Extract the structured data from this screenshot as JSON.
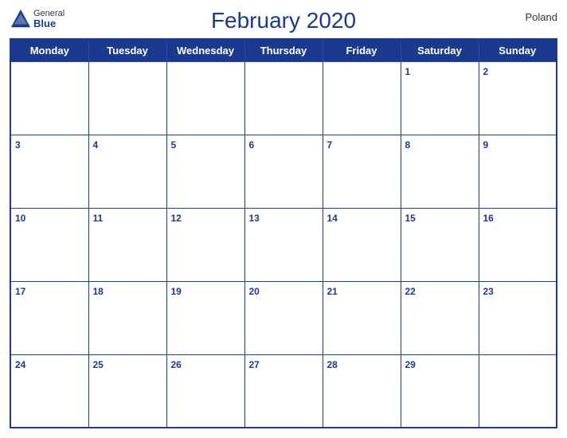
{
  "header": {
    "title": "February 2020",
    "country": "Poland",
    "logo": {
      "general": "General",
      "blue": "Blue"
    }
  },
  "weekdays": [
    "Monday",
    "Tuesday",
    "Wednesday",
    "Thursday",
    "Friday",
    "Saturday",
    "Sunday"
  ],
  "weeks": [
    [
      null,
      null,
      null,
      null,
      null,
      1,
      2
    ],
    [
      3,
      4,
      5,
      6,
      7,
      8,
      9
    ],
    [
      10,
      11,
      12,
      13,
      14,
      15,
      16
    ],
    [
      17,
      18,
      19,
      20,
      21,
      22,
      23
    ],
    [
      24,
      25,
      26,
      27,
      28,
      29,
      null
    ]
  ]
}
